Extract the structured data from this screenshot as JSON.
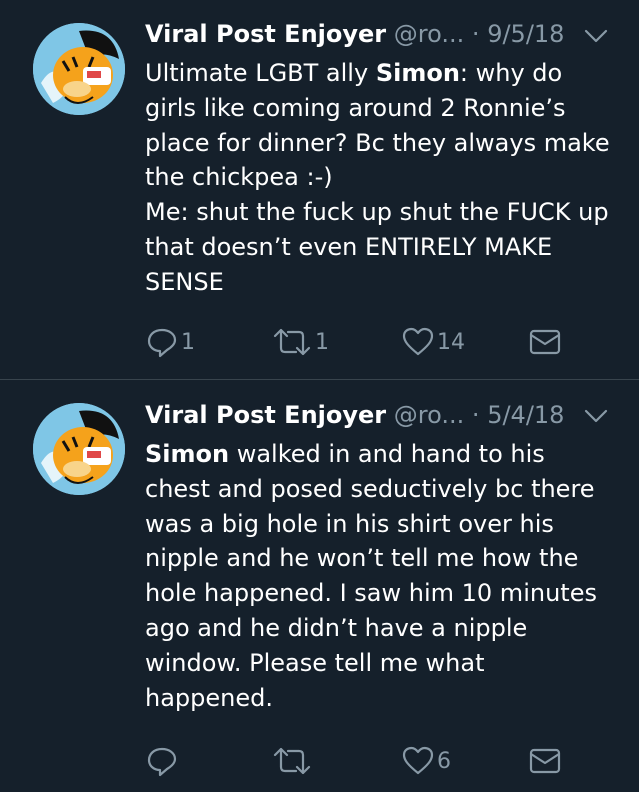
{
  "tweets": [
    {
      "display_name": "Viral Post Enjoyer",
      "handle": "@ro...",
      "separator": "·",
      "date": "9/5/18",
      "body_mention": "Simon",
      "body_before": "Ultimate LGBT ally ",
      "body_after": ": why do girls like coming around 2 Ronnie’s place for dinner? Bc they always make the chickpea :-)\nMe: shut the fuck up shut the FUCK up that doesn’t even ENTIRELY MAKE SENSE",
      "replies": "1",
      "retweets": "1",
      "likes": "14"
    },
    {
      "display_name": "Viral Post Enjoyer",
      "handle": "@ro...",
      "separator": "·",
      "date": "5/4/18",
      "body_mention": "Simon",
      "body_before": "",
      "body_after": " walked in and hand to his chest and posed seductively bc there was a big hole in his shirt over his nipple and he won’t tell me how the hole happened. I saw him 10 minutes ago and he didn’t have a nipple window. Please tell me what happened.",
      "replies": "",
      "retweets": "",
      "likes": "6"
    }
  ],
  "icons": {
    "reply": "reply-icon",
    "retweet": "retweet-icon",
    "like": "heart-icon",
    "message": "envelope-icon",
    "more": "chevron-down-icon"
  },
  "colors": {
    "background": "#15202b",
    "secondary_text": "#8899a6",
    "divider": "#38444d"
  }
}
